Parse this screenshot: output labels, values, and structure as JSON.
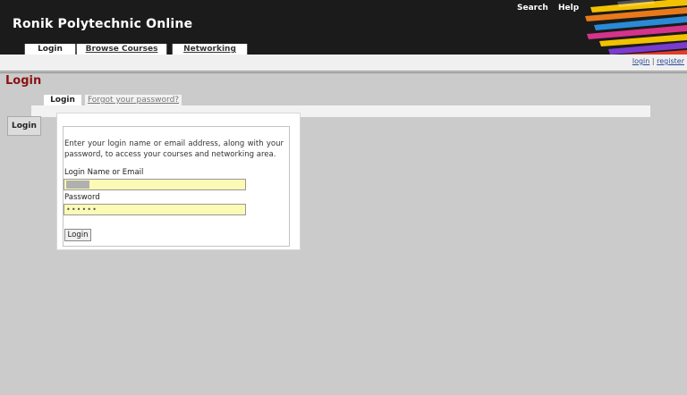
{
  "app": {
    "title": "Ronik Polytechnic Online"
  },
  "top_links": {
    "search": "Search",
    "help": "Help"
  },
  "nav": {
    "tabs": [
      {
        "label": "Login",
        "active": true
      },
      {
        "label": "Browse Courses",
        "active": false
      },
      {
        "label": "Networking",
        "active": false
      }
    ]
  },
  "auth": {
    "login": "login",
    "separator": "|",
    "register": "register"
  },
  "page": {
    "heading": "Login"
  },
  "subtabs": {
    "login": "Login",
    "forgot": "Forgot your password?"
  },
  "form": {
    "legend": "Login",
    "intro": "Enter your login name or email address, along with your password, to access your courses and networking area.",
    "name_label": "Login Name or Email",
    "password_label": "Password",
    "password_value": "••••••",
    "submit_label": "Login"
  },
  "colors": {
    "header_bg": "#1b1b1b",
    "heading": "#8b1212",
    "input_bg": "#fbfbb6",
    "page_bg": "#cbcbcb"
  },
  "icons": {
    "header_art": "colored-pencils-icon"
  }
}
